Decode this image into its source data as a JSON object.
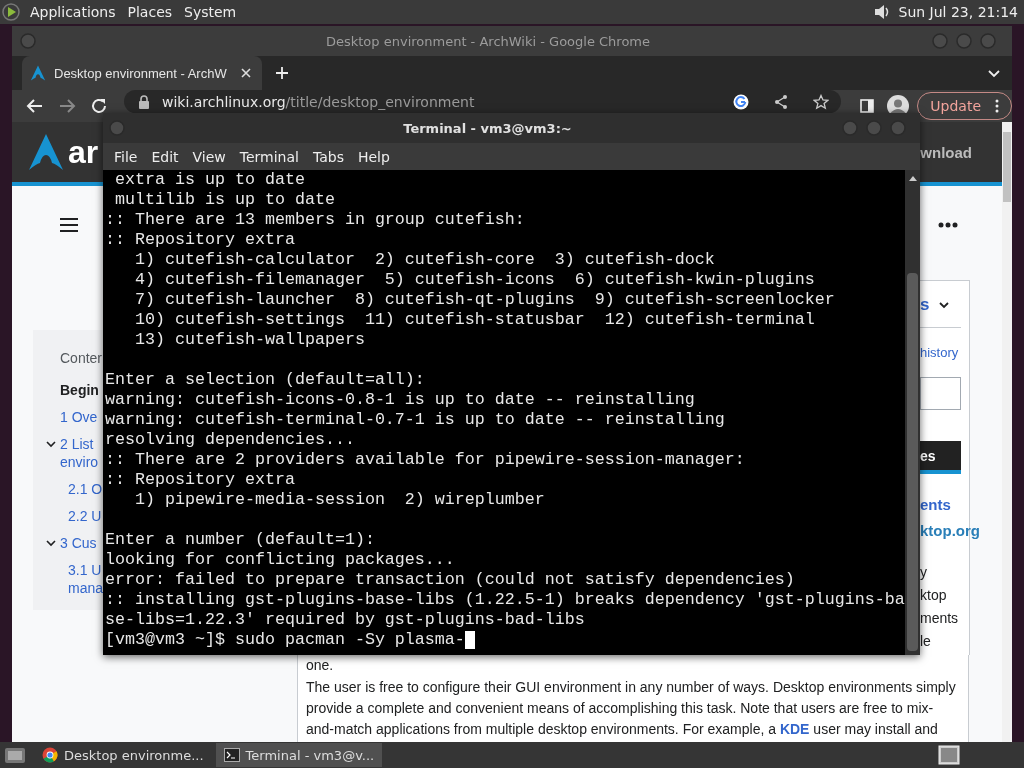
{
  "top_panel": {
    "menus": [
      "Applications",
      "Places",
      "System"
    ],
    "clock": "Sun Jul 23, 21:14"
  },
  "browser": {
    "title": "Desktop environment - ArchWiki - Google Chrome",
    "tabs": [
      {
        "label": "Desktop environment - ArchW",
        "selected": true
      }
    ],
    "address": {
      "host": "wiki.archlinux.org",
      "path": "/title/desktop_environment"
    },
    "update_button": "Update",
    "page": {
      "logo_text": "ar",
      "header_link": "wnload",
      "toc": {
        "heading": "Conter",
        "items": [
          {
            "lines": [
              "Begin"
            ],
            "selected": true
          },
          {
            "lines": [
              "1 Ove"
            ],
            "selected": false
          },
          {
            "lines": [
              "2 List",
              "enviro"
            ],
            "selected": false,
            "expanded": true,
            "children": [
              {
                "lines": [
                  "2.1 O"
                ],
                "selected": false
              },
              {
                "lines": [
                  "2.2 U"
                ],
                "selected": false
              }
            ]
          },
          {
            "lines": [
              "3 Cus"
            ],
            "selected": false,
            "expanded": true,
            "children": [
              {
                "lines": [
                  "3.1 U",
                  "mana"
                ],
                "selected": false
              }
            ]
          }
        ]
      },
      "tools": {
        "dropdown": "s",
        "link": "history",
        "button": "es",
        "links": [
          "ents",
          "ktop.org"
        ]
      },
      "article_fragments": [
        "y",
        "ktop",
        "ments",
        "le"
      ],
      "tail": "one.",
      "paragraph": {
        "before": "The user is free to configure their GUI environment in any number of ways. Desktop environments simply provide a complete and convenient means of accomplishing this task. Note that users are free to mix-and-match applications from multiple desktop environments. For example, a ",
        "link": "KDE",
        "after": " user may install and"
      }
    }
  },
  "terminal": {
    "title": "Terminal - vm3@vm3:~",
    "menus": [
      "File",
      "Edit",
      "View",
      "Terminal",
      "Tabs",
      "Help"
    ],
    "blocks": [
      [
        " extra is up to date",
        " multilib is up to date",
        ":: There are 13 members in group cutefish:",
        ":: Repository extra",
        "   1) cutefish-calculator  2) cutefish-core  3) cutefish-dock",
        "   4) cutefish-filemanager  5) cutefish-icons  6) cutefish-kwin-plugins",
        "   7) cutefish-launcher  8) cutefish-qt-plugins  9) cutefish-screenlocker",
        "   10) cutefish-settings  11) cutefish-statusbar  12) cutefish-terminal",
        "   13) cutefish-wallpapers"
      ],
      [
        "Enter a selection (default=all):",
        "warning: cutefish-icons-0.8-1 is up to date -- reinstalling",
        "warning: cutefish-terminal-0.7-1 is up to date -- reinstalling",
        "resolving dependencies...",
        ":: There are 2 providers available for pipewire-session-manager:",
        ":: Repository extra",
        "   1) pipewire-media-session  2) wireplumber"
      ],
      [
        "Enter a number (default=1):",
        "looking for conflicting packages...",
        "error: failed to prepare transaction (could not satisfy dependencies)",
        ":: installing gst-plugins-base-libs (1.22.5-1) breaks dependency 'gst-plugins-ba",
        "se-libs=1.22.3' required by gst-plugins-bad-libs"
      ]
    ],
    "prompt": "[vm3@vm3 ~]$ sudo pacman -Sy plasma-"
  },
  "taskbar": {
    "tasks": [
      {
        "kind": "browser",
        "label": "Desktop environme...",
        "selected": false
      },
      {
        "kind": "terminal",
        "label": "Terminal - vm3@v...",
        "selected": true
      }
    ]
  }
}
